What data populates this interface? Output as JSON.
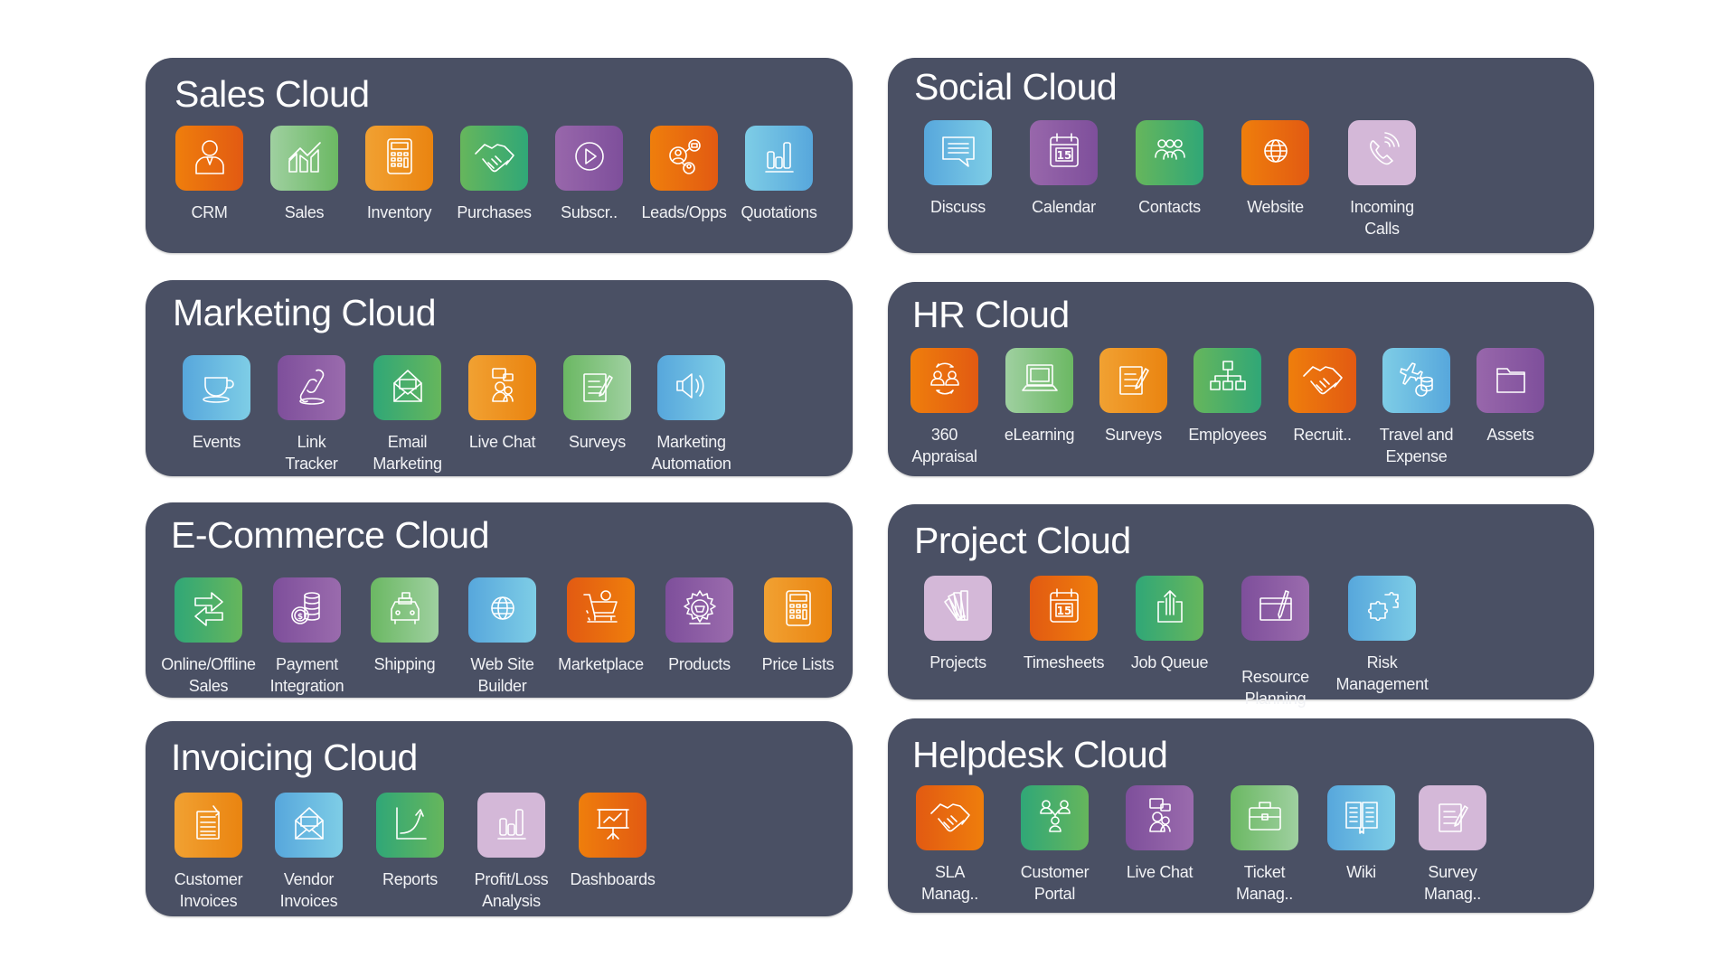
{
  "clouds": [
    {
      "title": "Sales Cloud",
      "apps": [
        {
          "label": "CRM",
          "icon": "person-tie-icon",
          "color": "orange"
        },
        {
          "label": "Sales",
          "icon": "growth-chart-icon",
          "color": "lgreen"
        },
        {
          "label": "Inventory",
          "icon": "calculator-icon",
          "color": "orange2"
        },
        {
          "label": "Purchases",
          "icon": "handshake-icon",
          "color": "green"
        },
        {
          "label": "Subscr..",
          "icon": "play-circle-icon",
          "color": "purple"
        },
        {
          "label": "Leads/Opps",
          "icon": "network-people-icon",
          "color": "orange"
        },
        {
          "label": "Quotations",
          "icon": "bar-chart-icon",
          "color": "blue"
        }
      ]
    },
    {
      "title": "Social Cloud",
      "apps": [
        {
          "label": "Discuss",
          "icon": "chat-bubble-icon",
          "color": "blue-r"
        },
        {
          "label": "Calendar",
          "icon": "calendar-icon",
          "color": "purple",
          "badge": "15"
        },
        {
          "label": "Contacts",
          "icon": "group-icon",
          "color": "green"
        },
        {
          "label": "Website",
          "icon": "globe-icon",
          "color": "orange"
        },
        {
          "label": "Incoming Calls",
          "icon": "phone-ringing-icon",
          "color": "lilac"
        }
      ]
    },
    {
      "title": "Marketing Cloud",
      "apps": [
        {
          "label": "Events",
          "icon": "coffee-cup-icon",
          "color": "blue-r"
        },
        {
          "label": "Link Tracker",
          "icon": "chain-link-icon",
          "color": "purple-r"
        },
        {
          "label": "Email Marketing",
          "icon": "envelope-open-icon",
          "color": "green-r"
        },
        {
          "label": "Live Chat",
          "icon": "live-chat-icon",
          "color": "orange2-r"
        },
        {
          "label": "Surveys",
          "icon": "survey-pen-icon",
          "color": "lgreen-r"
        },
        {
          "label": "Marketing Automation",
          "icon": "speaker-icon",
          "color": "blue-r"
        }
      ]
    },
    {
      "title": "HR Cloud",
      "apps": [
        {
          "label": "360 Appraisal",
          "icon": "appraisal-cycle-icon",
          "color": "orange"
        },
        {
          "label": "eLearning",
          "icon": "laptop-icon",
          "color": "lgreen"
        },
        {
          "label": "Surveys",
          "icon": "survey-pen-icon",
          "color": "orange2"
        },
        {
          "label": "Employees",
          "icon": "org-chart-icon",
          "color": "green"
        },
        {
          "label": "Recruit..",
          "icon": "handshake-icon",
          "color": "orange"
        },
        {
          "label": "Travel and Expense",
          "icon": "plane-coins-icon",
          "color": "blue"
        },
        {
          "label": "Assets",
          "icon": "folder-icon",
          "color": "purple"
        }
      ]
    },
    {
      "title": "E-Commerce Cloud",
      "apps": [
        {
          "label": "Online/Offline Sales",
          "icon": "swap-arrows-icon",
          "color": "green-r"
        },
        {
          "label": "Payment Integration",
          "icon": "coins-icon",
          "color": "purple-r"
        },
        {
          "label": "Shipping",
          "icon": "delivery-car-icon",
          "color": "lgreen-r"
        },
        {
          "label": "Web Site Builder",
          "icon": "globe-icon",
          "color": "blue-r"
        },
        {
          "label": "Marketplace",
          "icon": "shopping-cart-icon",
          "color": "orange-r"
        },
        {
          "label": "Products",
          "icon": "gear-basket-icon",
          "color": "purple-r"
        },
        {
          "label": "Price Lists",
          "icon": "calculator-icon",
          "color": "orange2-r"
        }
      ]
    },
    {
      "title": "Project Cloud",
      "apps": [
        {
          "label": "Projects",
          "icon": "swatch-fan-icon",
          "color": "lilac"
        },
        {
          "label": "Timesheets",
          "icon": "calendar-icon",
          "color": "orange-r",
          "badge": "15"
        },
        {
          "label": "Job Queue",
          "icon": "upload-box-icon",
          "color": "green-r"
        },
        {
          "label": "Resource Planning",
          "icon": "window-pen-icon",
          "color": "purple-r"
        },
        {
          "label": "Risk Management",
          "icon": "puzzle-icon",
          "color": "blue-r"
        }
      ]
    },
    {
      "title": "Invoicing Cloud",
      "apps": [
        {
          "label": "Customer Invoices",
          "icon": "invoice-icon",
          "color": "orange2-r"
        },
        {
          "label": "Vendor Invoices",
          "icon": "envelope-open-icon",
          "color": "blue-r"
        },
        {
          "label": "Reports",
          "icon": "trend-arrow-icon",
          "color": "green-r"
        },
        {
          "label": "Profit/Loss Analysis",
          "icon": "bar-chart-icon",
          "color": "lilac"
        },
        {
          "label": "Dashboards",
          "icon": "presentation-board-icon",
          "color": "orange"
        }
      ]
    },
    {
      "title": "Helpdesk Cloud",
      "apps": [
        {
          "label": "SLA Manag..",
          "icon": "handshake-icon",
          "color": "orange-r"
        },
        {
          "label": "Customer Portal",
          "icon": "people-tree-icon",
          "color": "green-r"
        },
        {
          "label": "Live Chat",
          "icon": "live-chat-icon",
          "color": "purple-r"
        },
        {
          "label": "Ticket Manag..",
          "icon": "briefcase-icon",
          "color": "lgreen-r"
        },
        {
          "label": "Wiki",
          "icon": "open-book-icon",
          "color": "blue-r"
        },
        {
          "label": "Survey Manag..",
          "icon": "survey-pen-icon",
          "color": "lilac"
        }
      ]
    }
  ]
}
